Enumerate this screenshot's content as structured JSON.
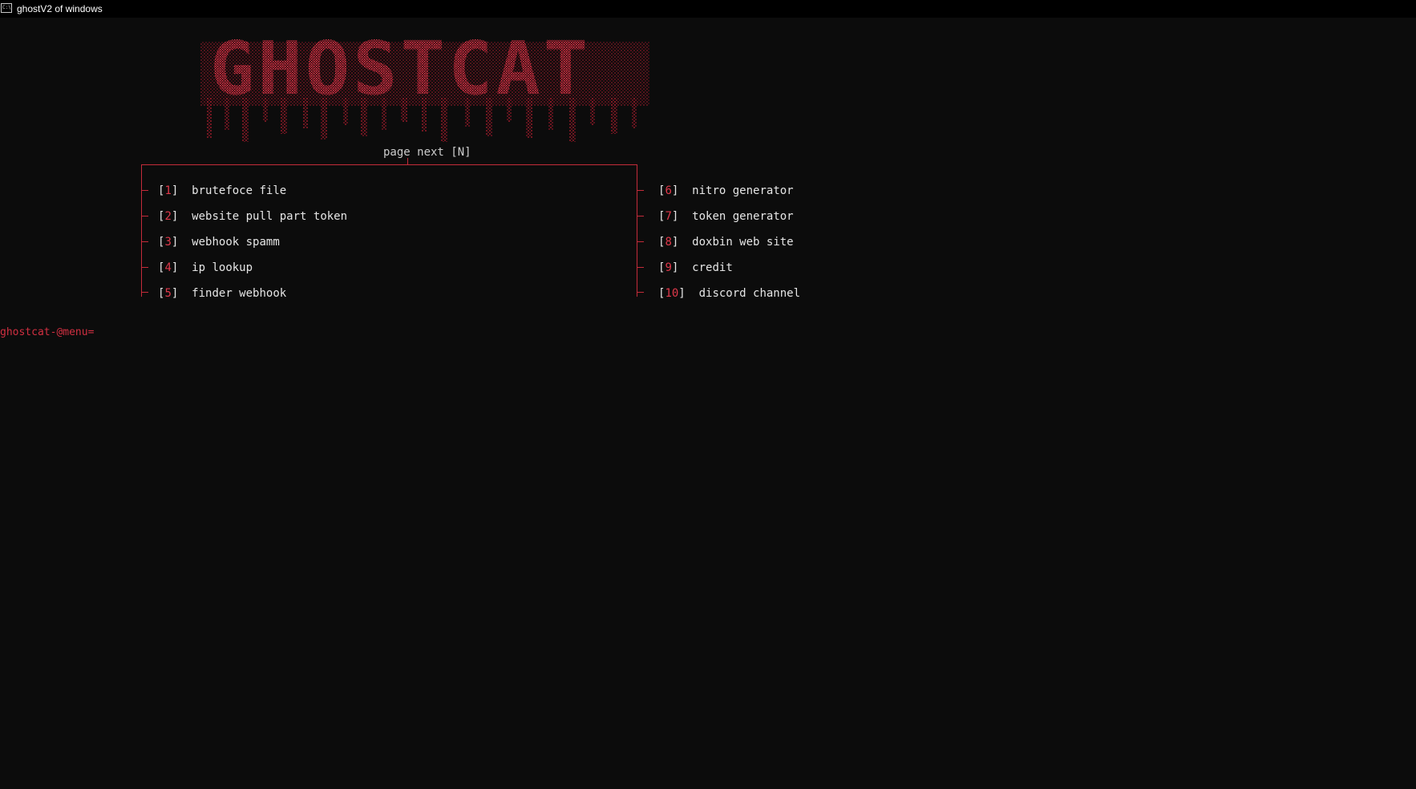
{
  "window": {
    "title": "ghostV2 of windows",
    "icon": "cmd-icon",
    "icon_glyph": "C:\\"
  },
  "logo": {
    "text": "GHOSTCAT",
    "color": "#e0394b"
  },
  "pager": {
    "label": "page next [N]"
  },
  "menu": {
    "left": [
      {
        "num": "1",
        "label": "brutefoce file"
      },
      {
        "num": "2",
        "label": "website pull part token"
      },
      {
        "num": "3",
        "label": "webhook spamm"
      },
      {
        "num": "4",
        "label": "ip lookup"
      },
      {
        "num": "5",
        "label": "finder webhook"
      }
    ],
    "right": [
      {
        "num": "6",
        "label": "nitro generator"
      },
      {
        "num": "7",
        "label": "token generator"
      },
      {
        "num": "8",
        "label": "doxbin web site"
      },
      {
        "num": "9",
        "label": "credit"
      },
      {
        "num": "10",
        "label": "discord channel"
      }
    ]
  },
  "prompt": {
    "text": "ghostcat-@menu="
  },
  "colors": {
    "background": "#0c0c0c",
    "accent": "#e0394b",
    "text": "#e6e6e6"
  }
}
